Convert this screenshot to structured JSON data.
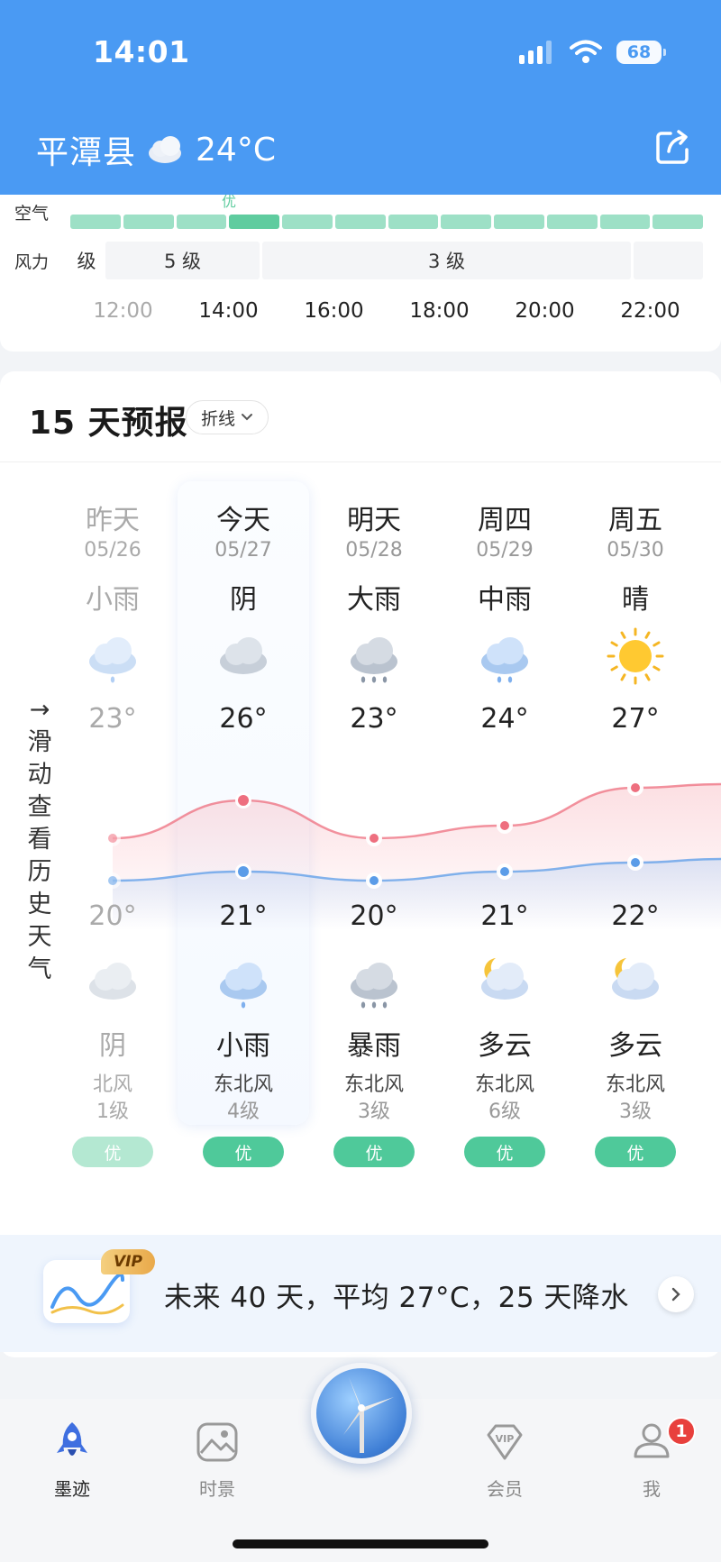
{
  "status_bar": {
    "time": "14:01",
    "battery": "68"
  },
  "header": {
    "city": "平潭县",
    "current_temp": "24°C"
  },
  "hourly": {
    "air_label": "空气",
    "air_top_label": "优",
    "wind_label": "风力",
    "wind_segments": [
      "级",
      "5 级",
      "3 级",
      ""
    ],
    "hours": [
      "12:00",
      "14:00",
      "16:00",
      "18:00",
      "20:00",
      "22:00"
    ]
  },
  "forecast": {
    "title": "15 天预报",
    "mode": "折线",
    "history_hint": [
      "→",
      "滑",
      "动",
      "查",
      "看",
      "历",
      "史",
      "天",
      "气"
    ],
    "days": [
      {
        "name": "昨天",
        "date": "05/26",
        "day_cond": "小雨",
        "high": "23°",
        "low": "20°",
        "night_cond": "阴",
        "wind_dir": "北风",
        "wind_lvl": "1级",
        "aq": "优",
        "day_icon": "light-rain-cloud-icon",
        "night_icon": "overcast-cloud-icon",
        "past": true
      },
      {
        "name": "今天",
        "date": "05/27",
        "day_cond": "阴",
        "high": "26°",
        "low": "21°",
        "night_cond": "小雨",
        "wind_dir": "东北风",
        "wind_lvl": "4级",
        "aq": "优",
        "day_icon": "overcast-cloud-icon",
        "night_icon": "light-rain-cloud-icon"
      },
      {
        "name": "明天",
        "date": "05/28",
        "day_cond": "大雨",
        "high": "23°",
        "low": "20°",
        "night_cond": "暴雨",
        "wind_dir": "东北风",
        "wind_lvl": "3级",
        "aq": "优",
        "day_icon": "heavy-rain-cloud-icon",
        "night_icon": "storm-rain-cloud-icon"
      },
      {
        "name": "周四",
        "date": "05/29",
        "day_cond": "中雨",
        "high": "24°",
        "low": "21°",
        "night_cond": "多云",
        "wind_dir": "东北风",
        "wind_lvl": "6级",
        "aq": "优",
        "day_icon": "moderate-rain-cloud-icon",
        "night_icon": "moon-cloud-icon"
      },
      {
        "name": "周五",
        "date": "05/30",
        "day_cond": "晴",
        "high": "27°",
        "low": "22°",
        "night_cond": "多云",
        "wind_dir": "东北风",
        "wind_lvl": "3级",
        "aq": "优",
        "day_icon": "sun-icon",
        "night_icon": "moon-cloud-icon"
      }
    ]
  },
  "promo": {
    "badge": "VIP",
    "text": "未来 40 天，平均 27°C，25 天降水"
  },
  "nav": {
    "items": [
      {
        "label": "墨迹",
        "icon": "rocket-icon",
        "active": true
      },
      {
        "label": "时景",
        "icon": "picture-icon"
      },
      {
        "label": "会员",
        "icon": "vip-diamond-icon"
      },
      {
        "label": "我",
        "icon": "profile-icon"
      }
    ],
    "badge_count": "1"
  },
  "colors": {
    "header_bg": "#4a9af3",
    "high_curve": "#ee6f7f",
    "low_curve": "#5b9ce8",
    "aq_good": "#4fc99a"
  }
}
